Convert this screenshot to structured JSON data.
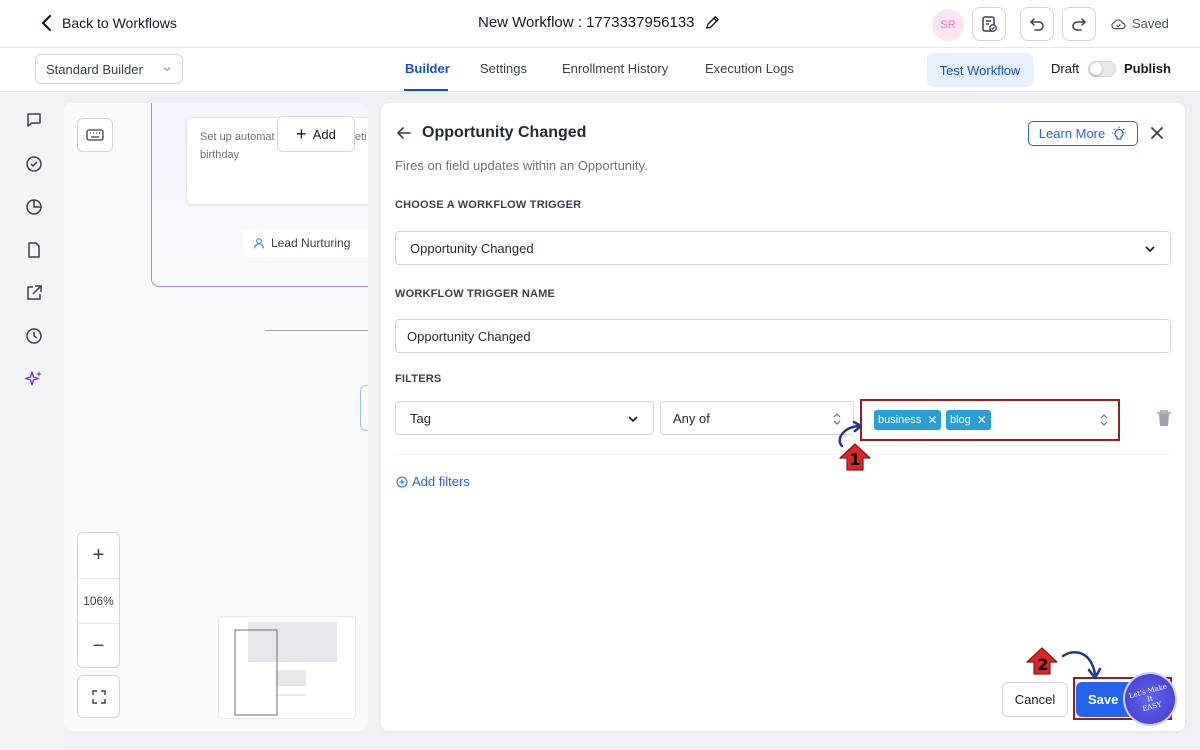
{
  "header": {
    "back_label": "Back to Workflows",
    "workflow_title": "New Workflow : 1773337956133",
    "avatar_initials": "SR",
    "saved_label": "Saved"
  },
  "navbar": {
    "builder_mode": "Standard Builder",
    "tabs": [
      {
        "label": "Builder",
        "active": true
      },
      {
        "label": "Settings",
        "active": false
      },
      {
        "label": "Enrollment History",
        "active": false
      },
      {
        "label": "Execution Logs",
        "active": false
      }
    ],
    "test_workflow_label": "Test Workflow",
    "draft_label": "Draft",
    "publish_label": "Publish",
    "is_published": false
  },
  "canvas": {
    "node_text": "Set up automat… birthday",
    "node_line1": "Set up automat",
    "node_line2": "birthday",
    "node_overflow": "eti",
    "add_label": "Add",
    "lead_tag_label": "Lead Nurturing",
    "zoom_in": "+",
    "zoom_level": "106%",
    "zoom_out": "−"
  },
  "panel": {
    "title": "Opportunity Changed",
    "learn_more_label": "Learn More",
    "description": "Fires on field updates within an Opportunity.",
    "trigger_section_label": "CHOOSE A WORKFLOW TRIGGER",
    "trigger_value": "Opportunity Changed",
    "name_section_label": "WORKFLOW TRIGGER NAME",
    "name_value": "Opportunity Changed",
    "filters_section_label": "FILTERS",
    "filter_field": "Tag",
    "filter_operator": "Any of",
    "filter_tags": [
      "business",
      "blog"
    ],
    "add_filters_label": "Add filters",
    "cancel_label": "Cancel",
    "save_label": "Save"
  },
  "annotations": {
    "step1": "1",
    "step2": "2",
    "watermark": "Let's Make It EASY",
    "watermark_line1": "Let's Make",
    "watermark_line2": "It",
    "watermark_line3": "EASY",
    "highlight_color": "#9b1c1c",
    "arrow_color": "#dc2626"
  },
  "colors": {
    "accent": "#2563eb",
    "tag_chip": "#2a9fd6",
    "group_border": "#a78bfa"
  }
}
